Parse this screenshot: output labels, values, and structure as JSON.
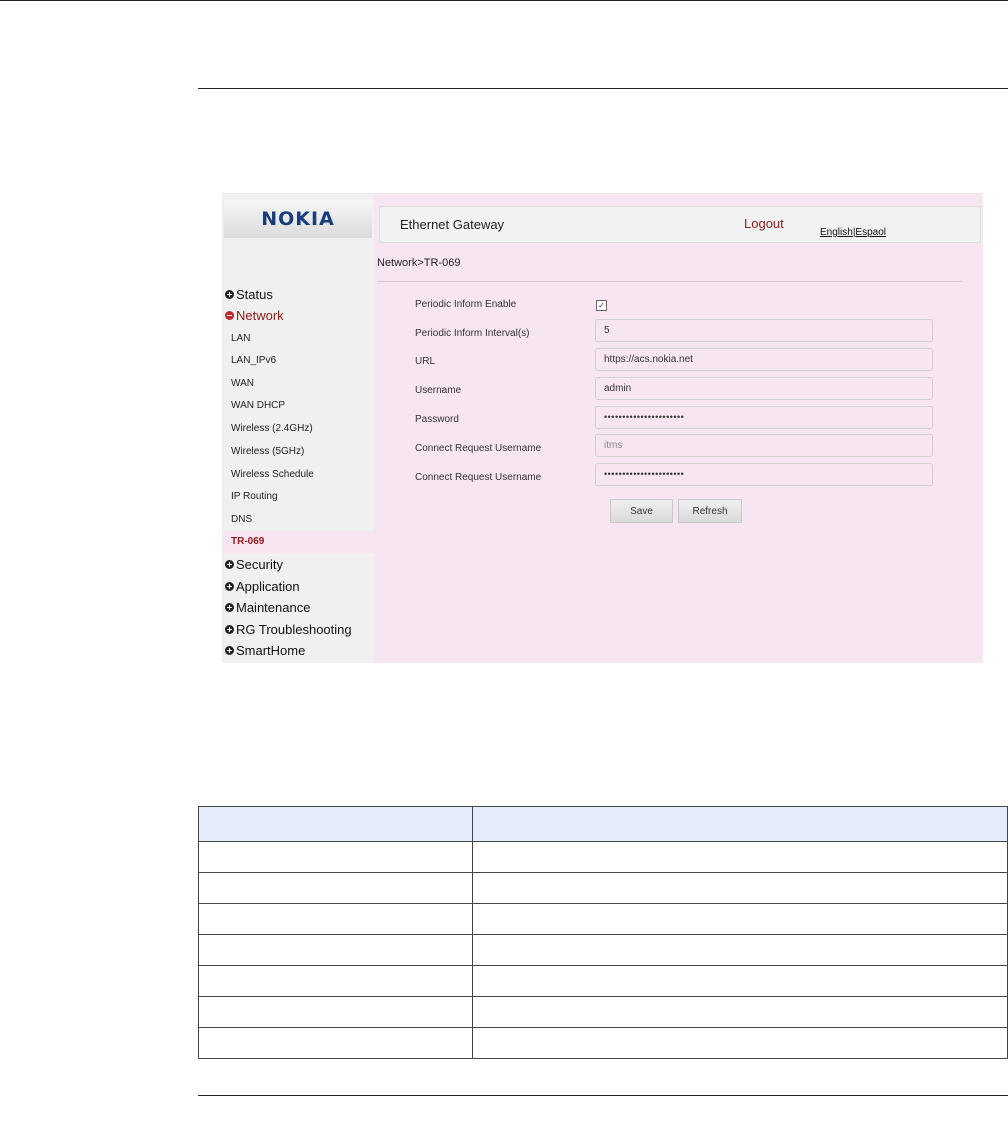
{
  "app": {
    "logo": "NOKIA",
    "title": "Ethernet Gateway",
    "logout": "Logout",
    "lang_english": "English",
    "lang_sep": "|",
    "lang_espanol": "Espaol"
  },
  "breadcrumb": "Network>TR-069",
  "menu": {
    "status": "Status",
    "network": "Network",
    "network_items": [
      "LAN",
      "LAN_IPv6",
      "WAN",
      "WAN DHCP",
      "Wireless (2.4GHz)",
      "Wireless (5GHz)",
      "Wireless Schedule",
      "IP Routing",
      "DNS",
      "TR-069"
    ],
    "security": "Security",
    "application": "Application",
    "maintenance": "Maintenance",
    "rg_troubleshooting": "RG Troubleshooting",
    "smarthome": "SmartHome"
  },
  "form": {
    "periodic_inform_enable_label": "Periodic Inform Enable",
    "periodic_inform_enable_checked": true,
    "interval_label": "Periodic Inform Interval(s)",
    "interval_value": "5",
    "url_label": "URL",
    "url_value": "https://acs.nokia.net",
    "username_label": "Username",
    "username_value": "admin",
    "password_label": "Password",
    "password_value": "••••••••••••••••••••••",
    "cr_username_label": "Connect Request Username",
    "cr_username_value": "itms",
    "cr_password_label": "Connect Request Username",
    "cr_password_value": "••••••••••••••••••••••",
    "save": "Save",
    "refresh": "Refresh"
  },
  "table": {
    "rows": 7
  }
}
